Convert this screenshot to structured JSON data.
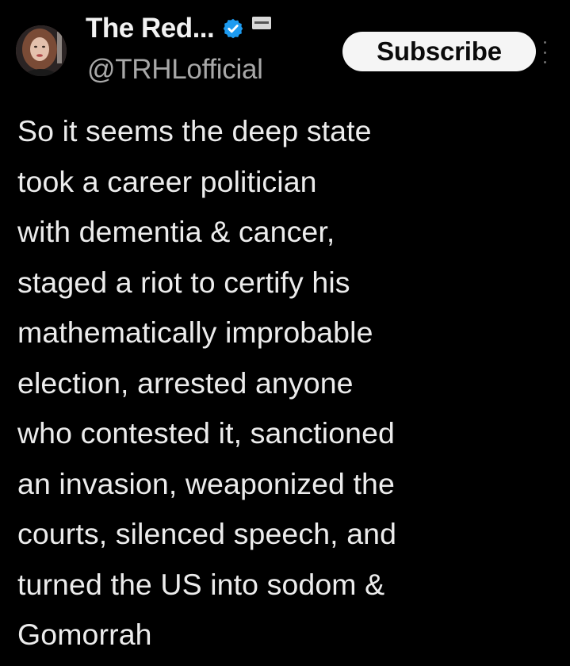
{
  "tweet": {
    "author": {
      "display_name": "The Red...",
      "handle": "@TRHLofficial",
      "verified_icon": "verified-checkmark-icon",
      "affiliate_badge_icon": "affiliate-badge-icon",
      "avatar_icon": "profile-photo"
    },
    "subscribe_label": "Subscribe",
    "more_icon": "more-options-icon",
    "body_lines": [
      "So it seems the deep state",
      "took a career politician",
      "with dementia & cancer,",
      "staged a riot to certify his",
      "mathematically improbable",
      "election, arrested anyone",
      "who contested it, sanctioned",
      "an invasion, weaponized the",
      "courts, silenced speech, and",
      "turned the US into sodom &",
      "Gomorrah"
    ]
  },
  "colors": {
    "background": "#000000",
    "text_primary": "#ececec",
    "text_secondary": "#a8a8a8",
    "verified_blue": "#1d9bf0",
    "button_bg": "#f5f5f5",
    "button_text": "#0b0b0b"
  }
}
